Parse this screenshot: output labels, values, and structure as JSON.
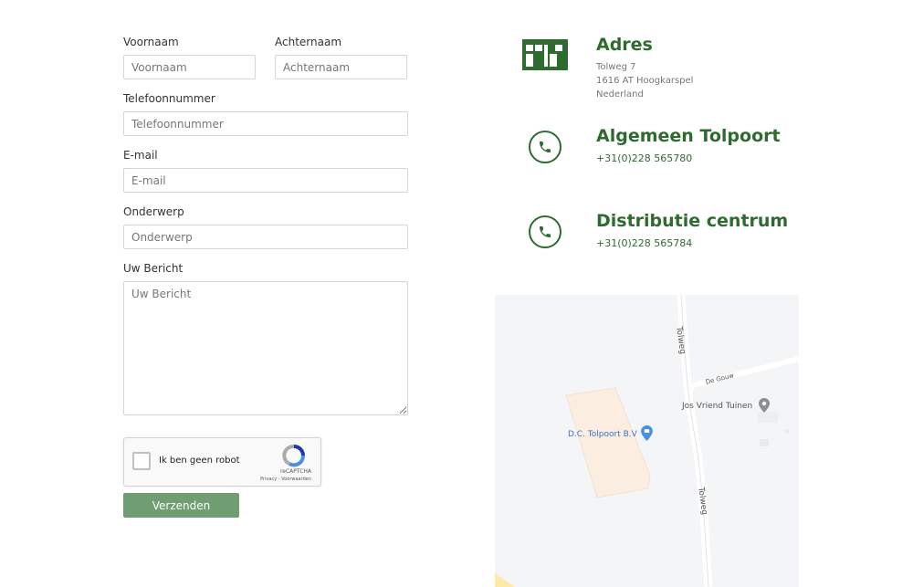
{
  "form": {
    "first_name": {
      "label": "Voornaam",
      "placeholder": "Voornaam"
    },
    "last_name": {
      "label": "Achternaam",
      "placeholder": "Achternaam"
    },
    "phone": {
      "label": "Telefoonnummer",
      "placeholder": "Telefoonnummer"
    },
    "email": {
      "label": "E-mail",
      "placeholder": "E-mail"
    },
    "subject": {
      "label": "Onderwerp",
      "placeholder": "Onderwerp"
    },
    "message": {
      "label": "Uw Bericht",
      "placeholder": "Uw Bericht"
    },
    "captcha": {
      "label": "Ik ben geen robot",
      "brand": "reCAPTCHA",
      "terms": "Privacy - Voorwaarden"
    },
    "submit_label": "Verzenden"
  },
  "contact": {
    "address": {
      "title": "Adres",
      "line1": "Tolweg 7",
      "line2": "1616 AT Hoogkarspel",
      "line3": "Nederland",
      "icon": "building-icon"
    },
    "general": {
      "title": "Algemeen Tolpoort",
      "phone": "+31(0)228 565780",
      "icon": "phone-icon"
    },
    "distribution": {
      "title": "Distributie centrum",
      "phone": "+31(0)228 565784",
      "icon": "phone-icon"
    }
  },
  "map": {
    "road_top": "Tolweg",
    "road_bottom": "Tolweg",
    "side_road": "De Gouw",
    "poi_jos": "Jos Vriend Tuinen",
    "poi_dc": "D.C. Tolpoort B.V"
  },
  "colors": {
    "brand_green": "#2e6b2e",
    "button_green": "#6f9e72",
    "map_pin_blue": "#4a90e2"
  }
}
